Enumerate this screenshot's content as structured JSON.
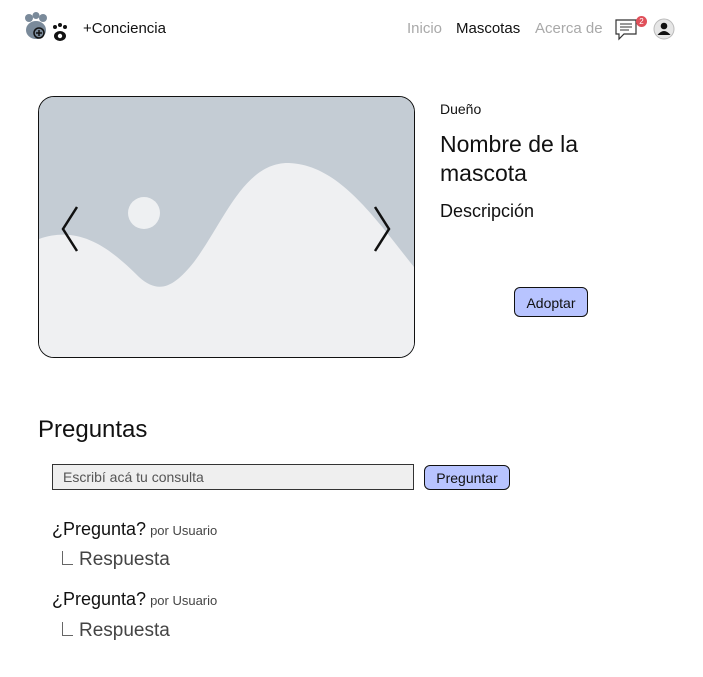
{
  "header": {
    "brand": "+Conciencia",
    "nav": [
      "Inicio",
      "Mascotas",
      "Acerca de"
    ],
    "active_nav": "Mascotas",
    "notification_count": "2",
    "icons": [
      "paw-logo-icon",
      "chat-icon",
      "user-avatar-icon"
    ]
  },
  "pet": {
    "owner": "Dueño",
    "name": "Nombre de la mascota",
    "description": "Descripción",
    "adopt_label": "Adoptar"
  },
  "questions": {
    "title": "Preguntas",
    "input_placeholder": "Escribí acá tu consulta",
    "ask_label": "Preguntar",
    "items": [
      {
        "question": "¿Pregunta?",
        "by": "por Usuario",
        "answer": "Respuesta"
      },
      {
        "question": "¿Pregunta?",
        "by": "por Usuario",
        "answer": "Respuesta"
      }
    ]
  },
  "colors": {
    "accent_button": "#b8c4ff",
    "badge": "#e0505a",
    "placeholder_image": "#c4ccd4"
  }
}
